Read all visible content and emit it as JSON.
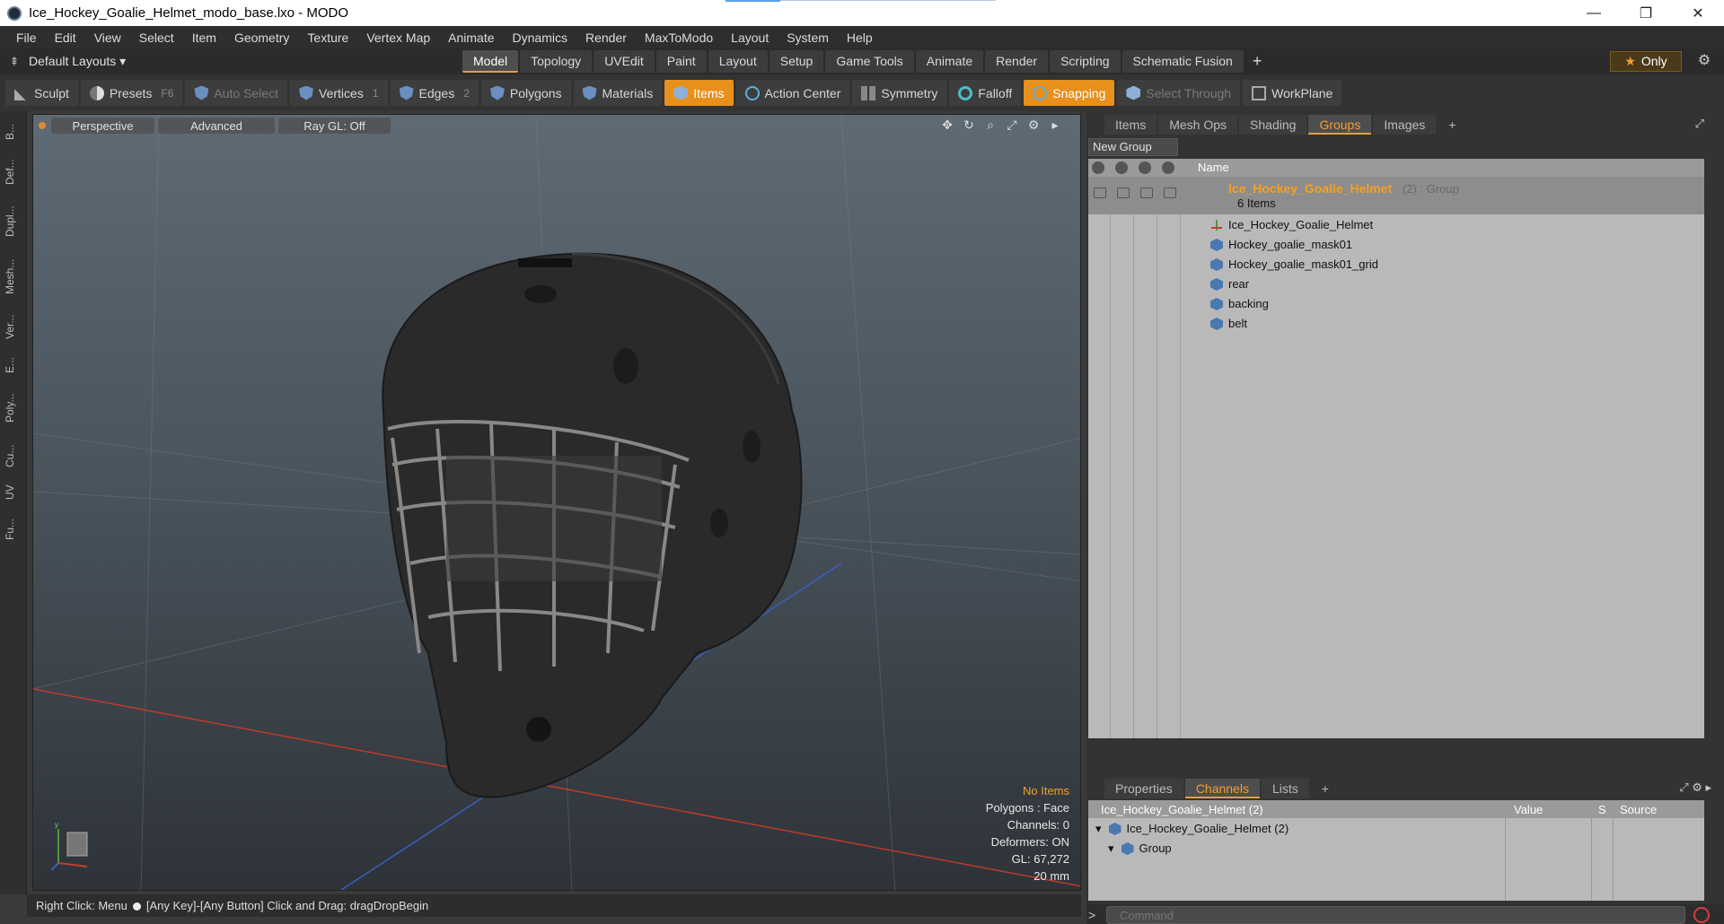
{
  "window": {
    "title": "Ice_Hockey_Goalie_Helmet_modo_base.lxo - MODO",
    "minimize": "—",
    "maximize": "❐",
    "close": "✕"
  },
  "menu": [
    "File",
    "Edit",
    "View",
    "Select",
    "Item",
    "Geometry",
    "Texture",
    "Vertex Map",
    "Animate",
    "Dynamics",
    "Render",
    "MaxToModo",
    "Layout",
    "System",
    "Help"
  ],
  "layout_row": {
    "layouts_label": "Default Layouts ▾",
    "tabs": [
      "Model",
      "Topology",
      "UVEdit",
      "Paint",
      "Layout",
      "Setup",
      "Game Tools",
      "Animate",
      "Render",
      "Scripting",
      "Schematic Fusion"
    ],
    "active_tab": "Model",
    "plus": "+",
    "only_label": "Only"
  },
  "toolbar": {
    "sculpt": "Sculpt",
    "presets": "Presets",
    "presets_key": "F6",
    "auto_select": "Auto Select",
    "vertices": "Vertices",
    "vertices_num": "1",
    "edges": "Edges",
    "edges_num": "2",
    "polygons": "Polygons",
    "materials": "Materials",
    "items": "Items",
    "action_center": "Action Center",
    "symmetry": "Symmetry",
    "falloff": "Falloff",
    "snapping": "Snapping",
    "select_through": "Select Through",
    "workplane": "WorkPlane"
  },
  "left_tabs": [
    "B...",
    "Def...",
    "Dupl...",
    "Mesh...",
    "Ver...",
    "E...",
    "Poly...",
    "Cu...",
    "UV",
    "Fu..."
  ],
  "viewport": {
    "perspective": "Perspective",
    "advanced": "Advanced",
    "raygl": "Ray GL: Off",
    "stats": {
      "no_items": "No Items",
      "polygons": "Polygons : Face",
      "channels": "Channels: 0",
      "deformers": "Deformers: ON",
      "gl": "GL: 67,272",
      "scale": "20 mm"
    }
  },
  "statusbar": {
    "left": "Right Click: Menu",
    "right": "[Any Key]-[Any Button] Click and Drag: dragDropBegin"
  },
  "right_panel": {
    "tabs": [
      "Items",
      "Mesh Ops",
      "Shading",
      "Groups",
      "Images"
    ],
    "active_tab": "Groups",
    "plus": "+",
    "new_group": "New Group",
    "name_header": "Name",
    "group": {
      "name": "Ice_Hockey_Goalie_Helmet",
      "meta": "(2) : Group",
      "count": "6 Items"
    },
    "items": [
      "Ice_Hockey_Goalie_Helmet",
      "Hockey_goalie_mask01",
      "Hockey_goalie_mask01_grid",
      "rear",
      "backing",
      "belt"
    ]
  },
  "lower_panel": {
    "tabs": [
      "Properties",
      "Channels",
      "Lists"
    ],
    "active_tab": "Channels",
    "plus": "+",
    "headers": {
      "name": "Ice_Hockey_Goalie_Helmet (2)",
      "value": "Value",
      "s": "S",
      "source": "Source"
    },
    "rows": [
      "Ice_Hockey_Goalie_Helmet (2)",
      "Group"
    ]
  },
  "command": {
    "prompt": ">",
    "placeholder": "Command"
  },
  "colors": {
    "accent": "#e8901c",
    "group_name": "#f6a020"
  }
}
